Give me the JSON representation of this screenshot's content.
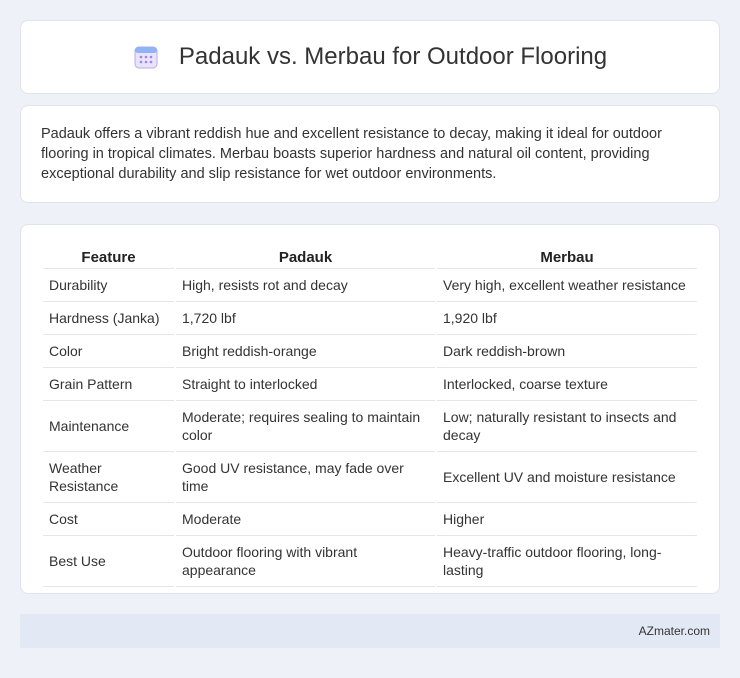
{
  "header": {
    "title": "Padauk vs. Merbau for Outdoor Flooring",
    "icon": "calendar-icon"
  },
  "intro": {
    "text": "Padauk offers a vibrant reddish hue and excellent resistance to decay, making it ideal for outdoor flooring in tropical climates. Merbau boasts superior hardness and natural oil content, providing exceptional durability and slip resistance for wet outdoor environments."
  },
  "table": {
    "headers": [
      "Feature",
      "Padauk",
      "Merbau"
    ],
    "rows": [
      [
        "Durability",
        "High, resists rot and decay",
        "Very high, excellent weather resistance"
      ],
      [
        "Hardness (Janka)",
        "1,720 lbf",
        "1,920 lbf"
      ],
      [
        "Color",
        "Bright reddish-orange",
        "Dark reddish-brown"
      ],
      [
        "Grain Pattern",
        "Straight to interlocked",
        "Interlocked, coarse texture"
      ],
      [
        "Maintenance",
        "Moderate; requires sealing to maintain color",
        "Low; naturally resistant to insects and decay"
      ],
      [
        "Weather Resistance",
        "Good UV resistance, may fade over time",
        "Excellent UV and moisture resistance"
      ],
      [
        "Cost",
        "Moderate",
        "Higher"
      ],
      [
        "Best Use",
        "Outdoor flooring with vibrant appearance",
        "Heavy-traffic outdoor flooring, long-lasting"
      ]
    ]
  },
  "footer": {
    "text": "AZmater.com"
  },
  "colors": {
    "background": "#eef1f7",
    "footer_bg": "#e3e9f4",
    "icon_accent": "#8c7ae6"
  }
}
